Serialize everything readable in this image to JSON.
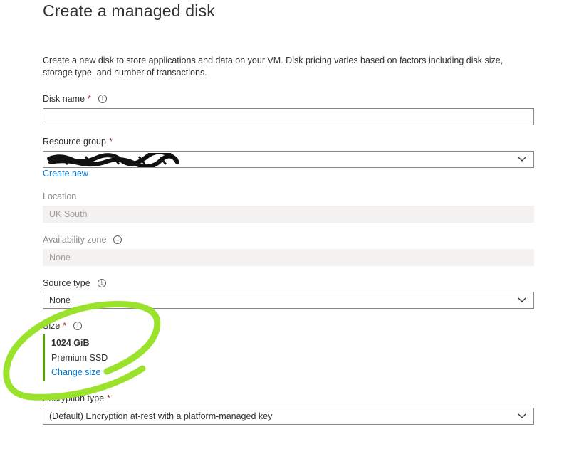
{
  "page": {
    "title": "Create a managed disk",
    "description": "Create a new disk to store applications and data on your VM. Disk pricing varies based on factors including disk size, storage type, and number of transactions."
  },
  "disk_name": {
    "label": "Disk name",
    "required_mark": "*",
    "value": ""
  },
  "resource_group": {
    "label": "Resource group",
    "required_mark": "*",
    "value_redacted": true,
    "create_new_label": "Create new"
  },
  "location": {
    "label": "Location",
    "value": "UK South"
  },
  "availability_zone": {
    "label": "Availability zone",
    "value": "None"
  },
  "source_type": {
    "label": "Source type",
    "value": "None"
  },
  "size": {
    "label": "Size",
    "required_mark": "*",
    "value": "1024 GiB",
    "tier": "Premium SSD",
    "change_label": "Change size"
  },
  "encryption_type": {
    "label": "Encryption type",
    "required_mark": "*",
    "value": "(Default) Encryption at-rest with a platform-managed key"
  },
  "colors": {
    "link": "#0078d4",
    "required": "#a4262c",
    "size_accent": "#57a300",
    "annotation": "#9be22d"
  },
  "icons": {
    "info": "info-icon",
    "dropdown": "chevron-down-icon"
  }
}
